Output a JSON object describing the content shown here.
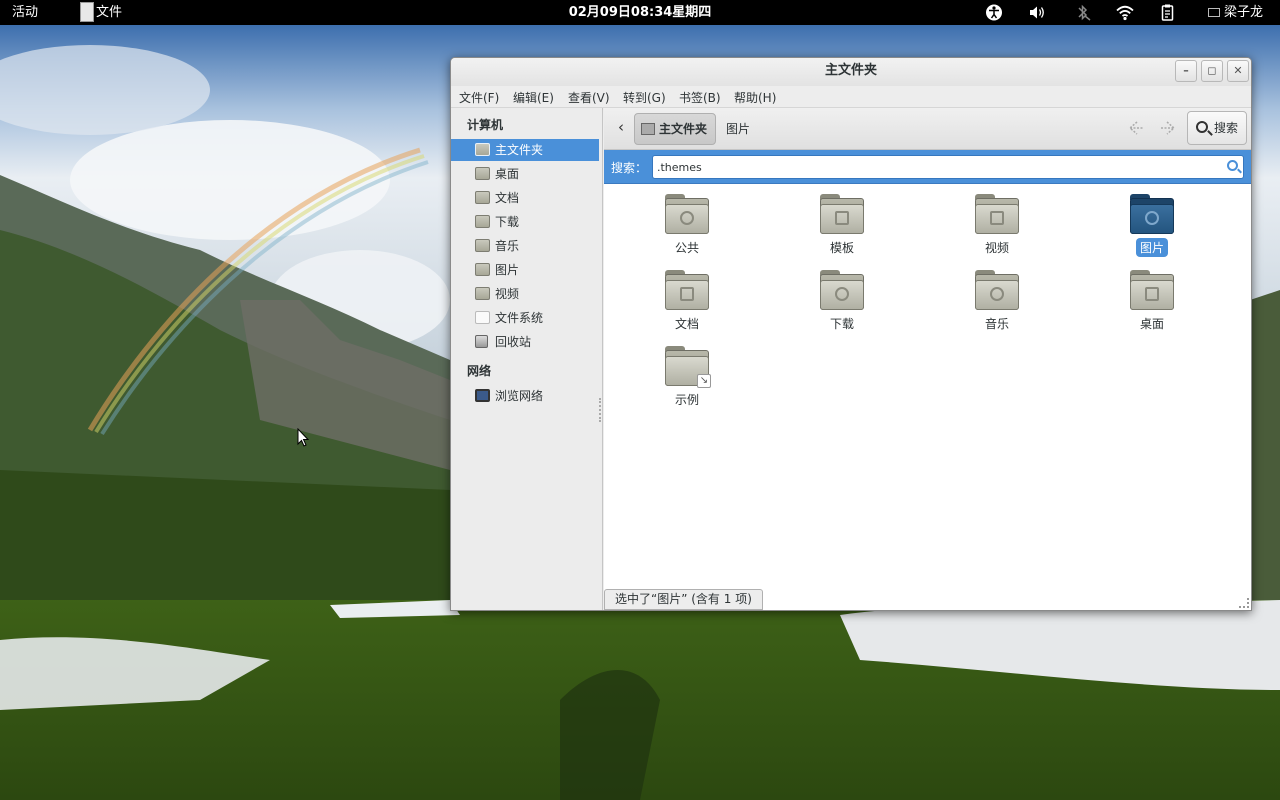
{
  "topbar": {
    "activities": "活动",
    "app_menu": "文件",
    "clock": "02月09日08:34星期四",
    "user": "梁子龙"
  },
  "window": {
    "title": "主文件夹",
    "buttons": {
      "minimize": "–",
      "maximize": "◻",
      "close": "✕"
    }
  },
  "menubar": {
    "file": "文件(F)",
    "edit": "编辑(E)",
    "view": "查看(V)",
    "go": "转到(G)",
    "bookmarks": "书签(B)",
    "help": "帮助(H)"
  },
  "sidebar": {
    "computer_heading": "计算机",
    "items": [
      {
        "label": "主文件夹"
      },
      {
        "label": "桌面"
      },
      {
        "label": "文档"
      },
      {
        "label": "下载"
      },
      {
        "label": "音乐"
      },
      {
        "label": "图片"
      },
      {
        "label": "视频"
      },
      {
        "label": "文件系统"
      },
      {
        "label": "回收站"
      }
    ],
    "network_heading": "网络",
    "network_items": [
      {
        "label": "浏览网络"
      }
    ]
  },
  "toolbar": {
    "back_glyph": "‹",
    "crumb_home": "主文件夹",
    "crumb_pictures": "图片",
    "search_button": "搜索"
  },
  "search": {
    "label": "搜索：",
    "value": ".themes"
  },
  "files": [
    {
      "name": "公共"
    },
    {
      "name": "模板"
    },
    {
      "name": "视频"
    },
    {
      "name": "图片"
    },
    {
      "name": "文档"
    },
    {
      "name": "下载"
    },
    {
      "name": "音乐"
    },
    {
      "name": "桌面"
    },
    {
      "name": "示例"
    }
  ],
  "statusbar": {
    "text": "选中了“图片” (含有 1 项)"
  },
  "colors": {
    "accent": "#4a90d9",
    "selected_folder": "#24557f",
    "topbar": "#000000"
  }
}
